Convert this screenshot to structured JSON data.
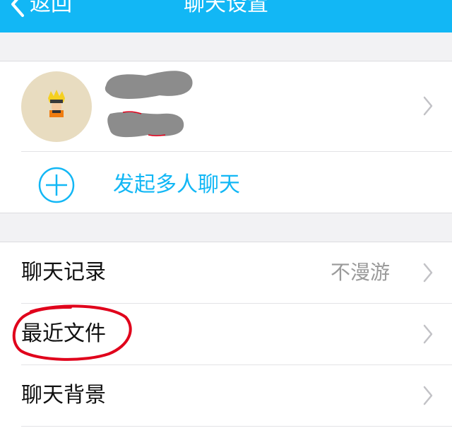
{
  "nav": {
    "back_label": "返回",
    "title": "聊天设置",
    "bar_color": "#12b7f5"
  },
  "contact": {
    "avatar_icon": "naruto-avatar-icon",
    "name_redacted": true
  },
  "group_chat": {
    "label": "发起多人聊天",
    "icon": "add-circle-icon"
  },
  "settings": {
    "items": [
      {
        "label": "聊天记录",
        "value": "不漫游",
        "icon": "chevron-right-icon"
      },
      {
        "label": "最近文件",
        "value": "",
        "icon": "chevron-right-icon"
      },
      {
        "label": "聊天背景",
        "value": "",
        "icon": "chevron-right-icon"
      }
    ]
  },
  "annotation": {
    "highlighted_item": "最近文件",
    "color": "#e0001b"
  }
}
